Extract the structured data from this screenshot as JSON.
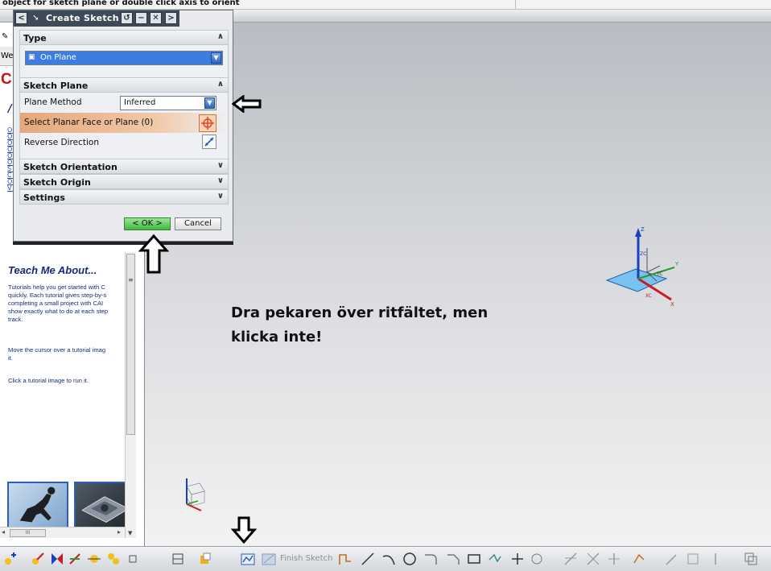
{
  "statusbar": {
    "prompt": "object for sketch plane or double click axis to orient"
  },
  "left_panel": {
    "tab_label": "We",
    "teach": {
      "title": "Teach Me About...",
      "line1": "Tutorials help you get started with C",
      "line2": "quickly. Each tutorial gives step-by-s",
      "line3": "completing a small project with CAI",
      "line4": "show exactly what to do at each step",
      "line5": "track.",
      "hover_line1": "Move the cursor over a tutorial imag",
      "hover_line2": "it.",
      "click_line": "Click a tutorial image to run it."
    }
  },
  "dialog": {
    "title": "Create Sketch",
    "sections": {
      "type": {
        "label": "Type",
        "value": "On Plane"
      },
      "sketch_plane": {
        "label": "Sketch Plane",
        "plane_method_label": "Plane Method",
        "plane_method_value": "Inferred",
        "select_label": "Select Planar Face or Plane (0)",
        "reverse_label": "Reverse Direction"
      },
      "sketch_orientation": {
        "label": "Sketch Orientation"
      },
      "sketch_origin": {
        "label": "Sketch Origin"
      },
      "settings": {
        "label": "Settings"
      }
    },
    "ok_label": "< OK >",
    "cancel_label": "Cancel"
  },
  "annotation": {
    "caption_line1": "Dra pekaren över ritfältet, men",
    "caption_line2": "klicka inte!"
  },
  "axes": {
    "z": "Z",
    "zc": "ZC",
    "y": "Y",
    "yc": "YC",
    "x": "X",
    "xc": "XC"
  },
  "toolbar": {
    "finish_sketch_label": "Finish Sketch"
  },
  "colors": {
    "accent": "#3d7ddf",
    "ok_green": "#3fb83e",
    "dialog_title": "#3e4a57"
  }
}
